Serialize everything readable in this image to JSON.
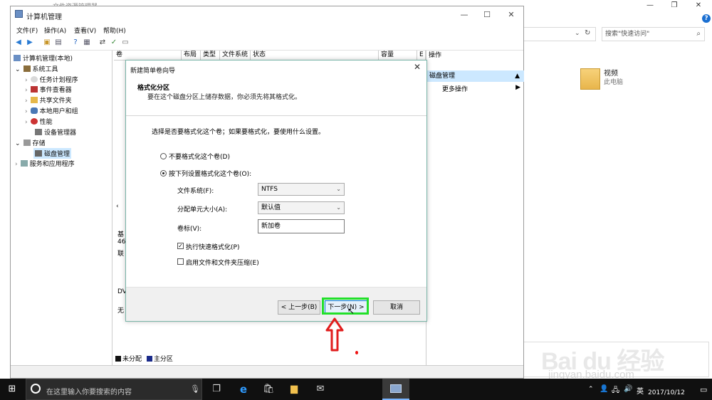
{
  "explorer": {
    "title": "文件资源管理器",
    "search_placeholder": "搜索\"快速访问\"",
    "item_title": "视频",
    "item_sub": "此电脑"
  },
  "watermark": {
    "logo": "Bai du 经验",
    "url": "jingyan.baidu.com"
  },
  "window": {
    "title": "计算机管理",
    "menu": [
      "文件(F)",
      "操作(A)",
      "查看(V)",
      "帮助(H)"
    ]
  },
  "tree": {
    "root": "计算机管理(本地)",
    "system_tools": "系统工具",
    "task_scheduler": "任务计划程序",
    "event_viewer": "事件查看器",
    "shared_folders": "共享文件夹",
    "local_users": "本地用户和组",
    "performance": "性能",
    "device_manager": "设备管理器",
    "storage": "存储",
    "disk_management": "磁盘管理",
    "services_apps": "服务和应用程序"
  },
  "columns": [
    "卷",
    "布局",
    "类型",
    "文件系统",
    "状态",
    "容量",
    "E"
  ],
  "actions": {
    "header": "操作",
    "selected": "磁盘管理",
    "more": "更多操作"
  },
  "partial": {
    "a": "基",
    "b": "46",
    "c": "联",
    "d": "DV",
    "e": "无"
  },
  "legend": {
    "unallocated": "未分配",
    "primary": "主分区"
  },
  "dialog": {
    "title": "新建简单卷向导",
    "heading": "格式化分区",
    "subheading": "要在这个磁盘分区上储存数据，你必须先将其格式化。",
    "prompt": "选择是否要格式化这个卷；如果要格式化，要使用什么设置。",
    "opt_no_format": "不要格式化这个卷(D)",
    "opt_format": "按下列设置格式化这个卷(O):",
    "fs_label": "文件系统(F):",
    "fs_value": "NTFS",
    "alloc_label": "分配单元大小(A):",
    "alloc_value": "默认值",
    "vol_label": "卷标(V):",
    "vol_value": "新加卷",
    "quick_format": "执行快速格式化(P)",
    "compression": "启用文件和文件夹压缩(E)",
    "btn_back": "< 上一步(B)",
    "btn_next": "下一步(N) >",
    "btn_cancel": "取消"
  },
  "taskbar": {
    "search": "在这里输入你要搜索的内容",
    "lang": "英",
    "date": "2017/10/12"
  },
  "colors": {
    "accent": "#0078d7",
    "highlight": "#22e02a",
    "arrow": "#e11d1d",
    "selection": "#cce8ff"
  }
}
